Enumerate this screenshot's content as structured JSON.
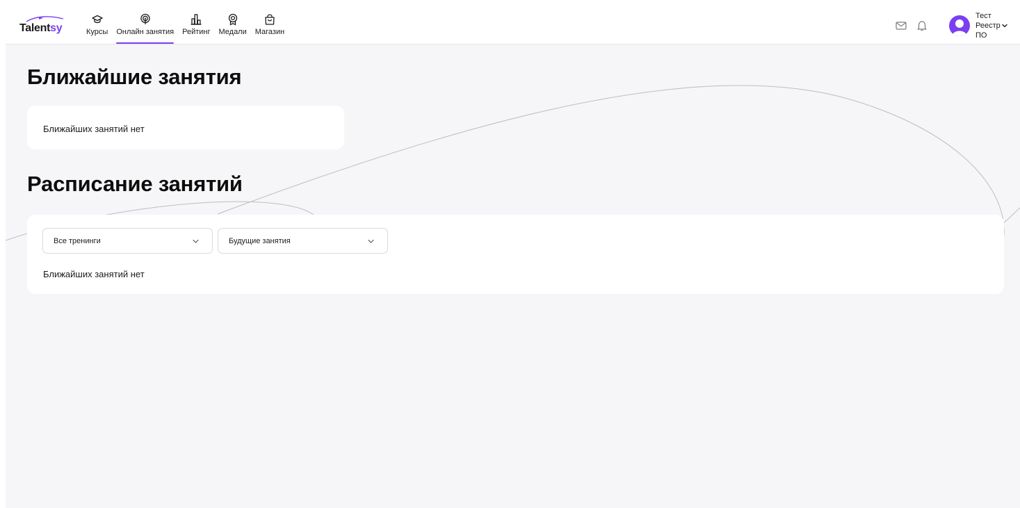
{
  "brand": {
    "logo_part1": "Talent",
    "logo_part2": "sy",
    "accent_color": "#7b3ff2"
  },
  "nav": {
    "items": [
      {
        "label": "Курсы",
        "icon": "graduation-cap-icon"
      },
      {
        "label": "Онлайн занятия",
        "icon": "broadcast-icon",
        "active": true
      },
      {
        "label": "Рейтинг",
        "icon": "bar-chart-icon"
      },
      {
        "label": "Медали",
        "icon": "medal-icon"
      },
      {
        "label": "Магазин",
        "icon": "shopping-bag-icon"
      }
    ]
  },
  "header": {
    "mail_icon": "mail-icon",
    "bell_icon": "bell-icon",
    "user": {
      "name_line1": "Тест",
      "name_line2": "Реестр",
      "name_line3": "ПО",
      "avatar_icon": "user-avatar-icon"
    }
  },
  "nearest": {
    "title": "Ближайшие занятия",
    "empty_text": "Ближайших занятий нет"
  },
  "schedule": {
    "title": "Расписание занятий",
    "filters": {
      "training": {
        "value": "Все тренинги"
      },
      "period": {
        "value": "Будущие занятия"
      }
    },
    "empty_text": "Ближайших занятий нет"
  }
}
